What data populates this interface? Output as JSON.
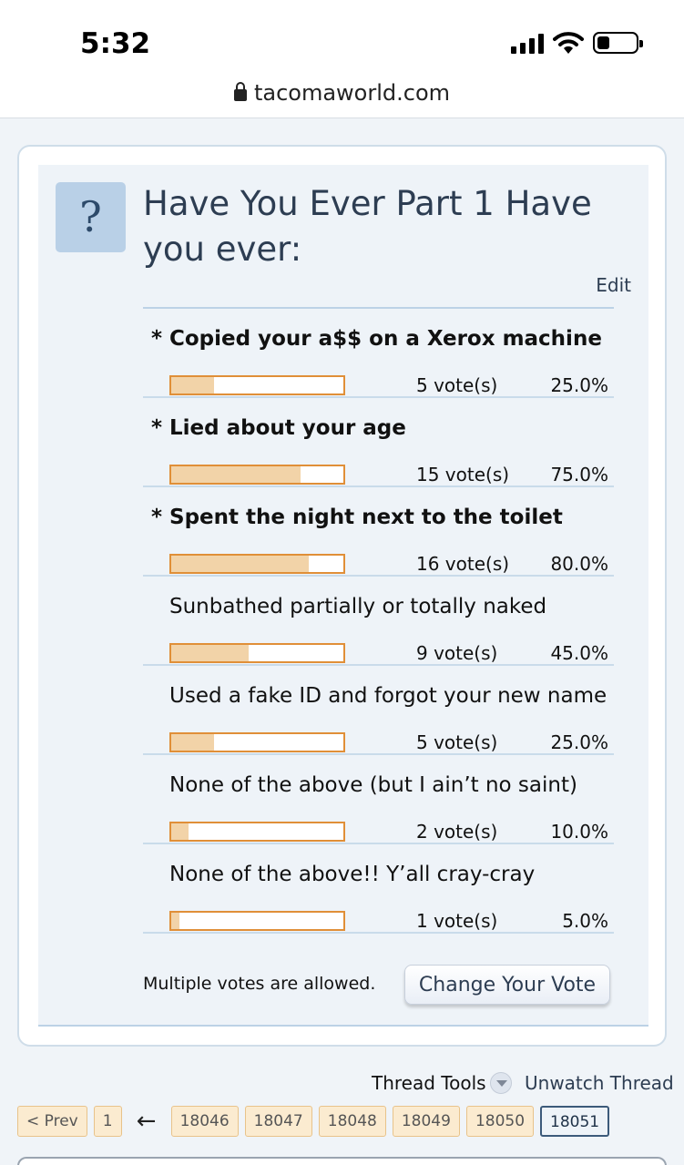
{
  "status_bar": {
    "time": "5:32",
    "url": "tacomaworld.com"
  },
  "poll": {
    "icon_text": "?",
    "title": "Have You Ever Part 1 Have you ever:",
    "edit_label": "Edit",
    "options": [
      {
        "label": "Copied your a$$ on a Xerox machine",
        "voted": true,
        "votes_text": "5 vote(s)",
        "percent_text": "25.0%",
        "percent": 25.0
      },
      {
        "label": "Lied about your age",
        "voted": true,
        "votes_text": "15 vote(s)",
        "percent_text": "75.0%",
        "percent": 75.0
      },
      {
        "label": "Spent the night next to the toilet",
        "voted": true,
        "votes_text": "16 vote(s)",
        "percent_text": "80.0%",
        "percent": 80.0
      },
      {
        "label": "Sunbathed partially or totally naked",
        "voted": false,
        "votes_text": "9 vote(s)",
        "percent_text": "45.0%",
        "percent": 45.0
      },
      {
        "label": "Used a fake ID and forgot your new name",
        "voted": false,
        "votes_text": "5 vote(s)",
        "percent_text": "25.0%",
        "percent": 25.0
      },
      {
        "label": "None of the above (but I ain’t no saint)",
        "voted": false,
        "votes_text": "2 vote(s)",
        "percent_text": "10.0%",
        "percent": 10.0
      },
      {
        "label": "None of the above!! Y’all cray-cray",
        "voted": false,
        "votes_text": "1 vote(s)",
        "percent_text": "5.0%",
        "percent": 5.0
      }
    ],
    "voted_marker": "*",
    "multiple_note": "Multiple votes are allowed.",
    "change_vote_label": "Change Your Vote"
  },
  "thread": {
    "tools_label": "Thread Tools",
    "unwatch_label": "Unwatch Thread"
  },
  "pagination": {
    "prev_label": "< Prev",
    "first_page": "1",
    "skip_arrow": "←",
    "pages": [
      "18046",
      "18047",
      "18048",
      "18049",
      "18050",
      "18051"
    ],
    "current_page": "18051"
  },
  "colors": {
    "bar_border": "#e08f38",
    "bar_fill": "#f2d3a8",
    "title_text": "#2d3d52",
    "panel_bg": "#eef3f8"
  },
  "icons": [
    "lock-icon",
    "signal-icon",
    "wifi-icon",
    "battery-icon",
    "question-icon",
    "dropdown-arrow-icon"
  ]
}
